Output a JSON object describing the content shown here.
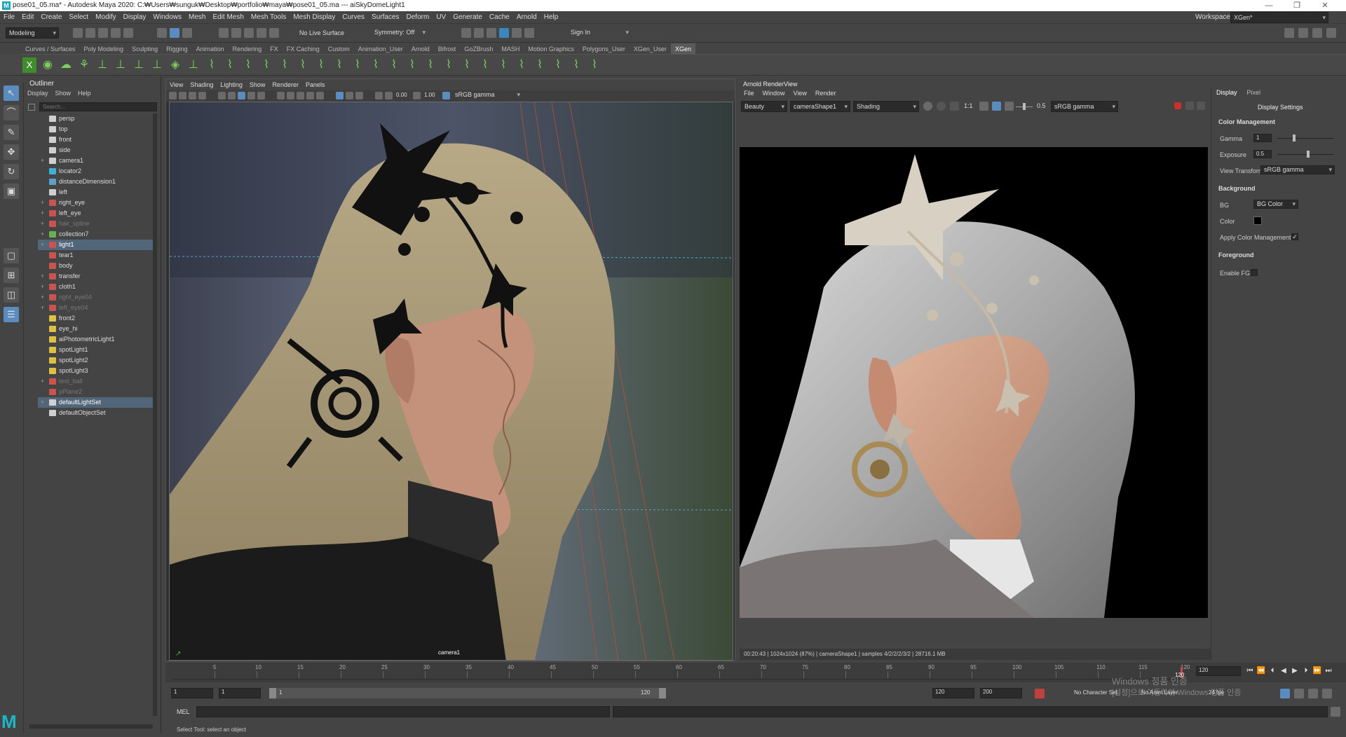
{
  "window": {
    "title": "pose01_05.ma* - Autodesk Maya 2020: C:₩Users₩sunguk₩Desktop₩portfolio₩maya₩pose01_05.ma   ---   aiSkyDomeLight1",
    "logo_letter": "M"
  },
  "menubar": [
    "File",
    "Edit",
    "Create",
    "Select",
    "Modify",
    "Display",
    "Windows",
    "Mesh",
    "Edit Mesh",
    "Mesh Tools",
    "Mesh Display",
    "Curves",
    "Surfaces",
    "Deform",
    "UV",
    "Generate",
    "Cache",
    "Arnold",
    "Help"
  ],
  "workspace": {
    "label": "Workspace :",
    "value": "XGen*"
  },
  "statusline": {
    "mode": "Modeling",
    "live_surface": "No Live Surface",
    "symmetry": "Symmetry: Off",
    "sign_in": "Sign In"
  },
  "shelf_tabs": [
    "Curves / Surfaces",
    "Poly Modeling",
    "Sculpting",
    "Rigging",
    "Animation",
    "Rendering",
    "FX",
    "FX Caching",
    "Custom",
    "Animation_User",
    "Arnold",
    "Bifrost",
    "GoZBrush",
    "MASH",
    "Motion Graphics",
    "Polygons_User",
    "XGen_User",
    "XGen"
  ],
  "shelf_active": "XGen",
  "outliner": {
    "title": "Outliner",
    "menu": [
      "Display",
      "Show",
      "Help"
    ],
    "search_placeholder": "Search...",
    "items": [
      {
        "label": "persp",
        "icon": "camera-icon",
        "color": "#cfcfcf",
        "expand": "",
        "dim": false,
        "selected": false
      },
      {
        "label": "top",
        "icon": "camera-icon",
        "color": "#cfcfcf",
        "expand": "",
        "dim": false,
        "selected": false
      },
      {
        "label": "front",
        "icon": "camera-icon",
        "color": "#cfcfcf",
        "expand": "",
        "dim": false,
        "selected": false
      },
      {
        "label": "side",
        "icon": "camera-icon",
        "color": "#cfcfcf",
        "expand": "",
        "dim": false,
        "selected": false
      },
      {
        "label": "camera1",
        "icon": "camera-icon",
        "color": "#cfcfcf",
        "expand": "+",
        "dim": false,
        "selected": false
      },
      {
        "label": "locator2",
        "icon": "locator-icon",
        "color": "#3fb0d8",
        "expand": "",
        "dim": false,
        "selected": false
      },
      {
        "label": "distanceDimension1",
        "icon": "measure-icon",
        "color": "#5aa0c8",
        "expand": "",
        "dim": false,
        "selected": false
      },
      {
        "label": "left",
        "icon": "camera-icon",
        "color": "#cfcfcf",
        "expand": "",
        "dim": false,
        "selected": false
      },
      {
        "label": "right_eye",
        "icon": "mesh-icon",
        "color": "#c8534f",
        "expand": "+",
        "dim": false,
        "selected": false
      },
      {
        "label": "left_eye",
        "icon": "mesh-icon",
        "color": "#c8534f",
        "expand": "+",
        "dim": false,
        "selected": false
      },
      {
        "label": "hair_spline",
        "icon": "mesh-icon",
        "color": "#c8534f",
        "expand": "+",
        "dim": true,
        "selected": false
      },
      {
        "label": "collection7",
        "icon": "xgen-icon",
        "color": "#6ab04c",
        "expand": "+",
        "dim": false,
        "selected": false
      },
      {
        "label": "light1",
        "icon": "mesh-icon",
        "color": "#c8534f",
        "expand": "+",
        "dim": false,
        "selected": true
      },
      {
        "label": "tear1",
        "icon": "mesh-icon",
        "color": "#c8534f",
        "expand": "",
        "dim": false,
        "selected": false
      },
      {
        "label": "body",
        "icon": "mesh-icon",
        "color": "#c8534f",
        "expand": "",
        "dim": false,
        "selected": false
      },
      {
        "label": "transfer",
        "icon": "mesh-icon",
        "color": "#c8534f",
        "expand": "+",
        "dim": false,
        "selected": false
      },
      {
        "label": "cloth1",
        "icon": "mesh-icon",
        "color": "#c8534f",
        "expand": "+",
        "dim": false,
        "selected": false
      },
      {
        "label": "right_eye04",
        "icon": "mesh-icon",
        "color": "#c8534f",
        "expand": "+",
        "dim": true,
        "selected": false
      },
      {
        "label": "left_eye04",
        "icon": "mesh-icon",
        "color": "#c8534f",
        "expand": "+",
        "dim": true,
        "selected": false
      },
      {
        "label": "front2",
        "icon": "light-icon",
        "color": "#e0c040",
        "expand": "",
        "dim": false,
        "selected": false
      },
      {
        "label": "eye_hi",
        "icon": "light-icon",
        "color": "#e0c040",
        "expand": "",
        "dim": false,
        "selected": false
      },
      {
        "label": "aiPhotometricLight1",
        "icon": "light-icon",
        "color": "#e0c040",
        "expand": "",
        "dim": false,
        "selected": false
      },
      {
        "label": "spotLight1",
        "icon": "light-icon",
        "color": "#e0c040",
        "expand": "",
        "dim": false,
        "selected": false
      },
      {
        "label": "spotLight2",
        "icon": "light-icon",
        "color": "#e0c040",
        "expand": "",
        "dim": false,
        "selected": false
      },
      {
        "label": "spotLight3",
        "icon": "light-icon",
        "color": "#e0c040",
        "expand": "",
        "dim": false,
        "selected": false
      },
      {
        "label": "test_ball",
        "icon": "mesh-icon",
        "color": "#c8534f",
        "expand": "+",
        "dim": true,
        "selected": false
      },
      {
        "label": "pPlane2",
        "icon": "mesh-icon",
        "color": "#c8534f",
        "expand": "",
        "dim": true,
        "selected": false
      },
      {
        "label": "defaultLightSet",
        "icon": "set-icon",
        "color": "#cfcfcf",
        "expand": "+",
        "dim": false,
        "selected": true
      },
      {
        "label": "defaultObjectSet",
        "icon": "set-icon",
        "color": "#cfcfcf",
        "expand": "",
        "dim": false,
        "selected": false
      }
    ]
  },
  "viewport": {
    "menu": [
      "View",
      "Shading",
      "Lighting",
      "Show",
      "Renderer",
      "Panels"
    ],
    "near": "0.00",
    "far": "1.00",
    "color_space": "sRGB gamma",
    "camera_label": "camera1"
  },
  "renderview": {
    "title": "Arnold RenderView",
    "menu": [
      "File",
      "Window",
      "View",
      "Render"
    ],
    "aov": "Beauty",
    "camera": "cameraShape1",
    "shading": "Shading",
    "ratio": "1:1",
    "exposure": "0.5",
    "color_space": "sRGB gamma",
    "status": "00:20:43 | 1024x1024 (87%) | cameraShape1 | samples 4/2/2/2/3/2 | 28716.1 MB"
  },
  "display_settings": {
    "tabs": [
      "Display",
      "Pixel"
    ],
    "title": "Display Settings",
    "color_management_head": "Color Management",
    "gamma_label": "Gamma",
    "gamma_value": "1",
    "exposure_label": "Exposure",
    "exposure_value": "0.5",
    "view_transform_label": "View Transform",
    "view_transform_value": "sRGB gamma",
    "background_head": "Background",
    "bg_label": "BG",
    "bg_value": "BG Color",
    "color_label": "Color",
    "apply_cm_label": "Apply Color Management",
    "apply_cm_checked": "✓",
    "foreground_head": "Foreground",
    "enable_fg_label": "Enable FG"
  },
  "timeslider": {
    "ticks": [
      "5",
      "10",
      "15",
      "20",
      "25",
      "30",
      "35",
      "40",
      "45",
      "50",
      "55",
      "60",
      "65",
      "70",
      "75",
      "80",
      "85",
      "90",
      "95",
      "100",
      "105",
      "110",
      "115",
      "120"
    ],
    "current_frame": "120",
    "current_marker": "120"
  },
  "rangeslider": {
    "start": "1",
    "playback_start": "1",
    "range_left": "1",
    "range_right": "120",
    "playback_end": "120",
    "end": "200",
    "character_set": "No Character Set",
    "anim_layer": "No Anim Layer",
    "fps": "24 fps"
  },
  "cmdline": {
    "label": "MEL"
  },
  "helpline": "Select Tool: select an object",
  "watermark": {
    "line1": "Windows 정품 인증",
    "line2": "[설정]으로 이동하여 Windows 정품 인증"
  }
}
